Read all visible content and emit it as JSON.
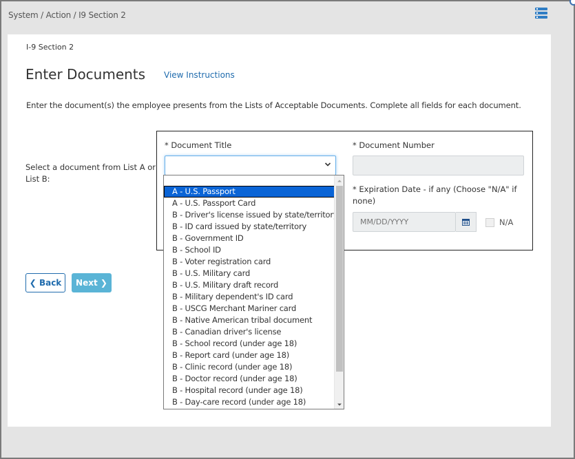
{
  "breadcrumb": "System / Action / I9 Section 2",
  "icons": {
    "menu": "list-menu-icon",
    "calendar": "calendar-icon",
    "chevron": "chevron-down-icon"
  },
  "colors": {
    "accent": "#1f6bad",
    "next_button": "#5ab4d6",
    "selected": "#0a64d6"
  },
  "section_label": "I-9 Section 2",
  "page_title": "Enter Documents",
  "view_instructions": "View Instructions",
  "intro": "Enter the document(s) the employee presents from the Lists of Acceptable Documents. Complete all fields for each document.",
  "select_prompt": "Select a document from List A or List B:",
  "form": {
    "doc_title_label": "* Document Title",
    "doc_title_value": "",
    "doc_number_label": "* Document Number",
    "doc_number_value": "",
    "expiration_label": "* Expiration Date - if any (Choose \"N/A\" if none)",
    "expiration_placeholder": "MM/DD/YYYY",
    "na_label": "N/A"
  },
  "buttons": {
    "back": "Back",
    "next": "Next"
  },
  "dropdown": {
    "selected_index": 0,
    "options": [
      "A - U.S. Passport",
      "A - U.S. Passport Card",
      "B - Driver's license issued by state/territory",
      "B - ID card issued by state/territory",
      "B - Government ID",
      "B - School ID",
      "B - Voter registration card",
      "B - U.S. Military card",
      "B - U.S. Military draft record",
      "B - Military dependent's ID card",
      "B - USCG Merchant Mariner card",
      "B - Native American tribal document",
      "B - Canadian driver's license",
      "B - School record (under age 18)",
      "B - Report card (under age 18)",
      "B - Clinic record (under age 18)",
      "B - Doctor record (under age 18)",
      "B - Hospital record (under age 18)",
      "B - Day-care record (under age 18)"
    ]
  }
}
